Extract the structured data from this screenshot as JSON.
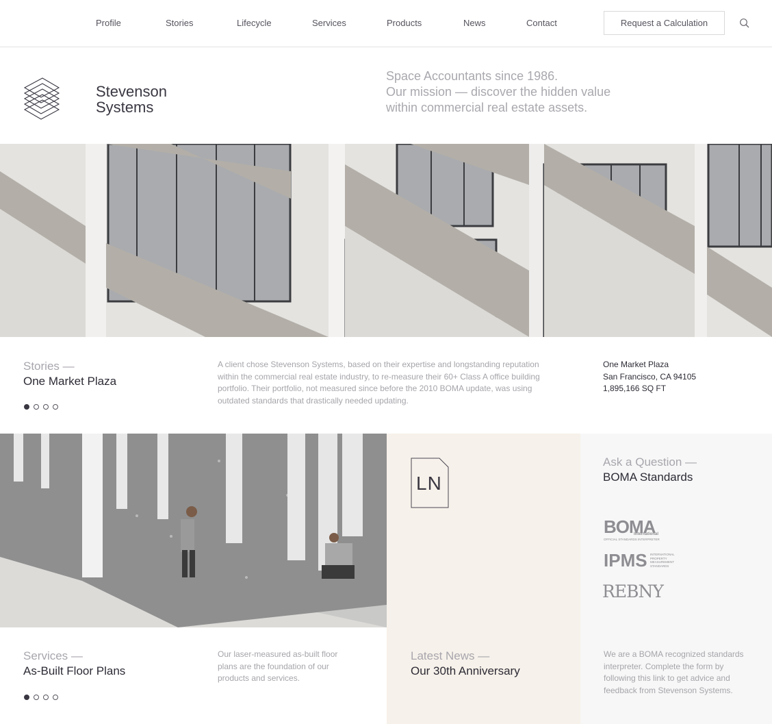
{
  "nav": {
    "items": [
      "Profile",
      "Stories",
      "Lifecycle",
      "Services",
      "Products",
      "News",
      "Contact"
    ],
    "cta": "Request a Calculation",
    "search_icon": "search-icon"
  },
  "brand": {
    "name_line1": "Stevenson",
    "name_line2": "Systems",
    "logo_icon": "stacked-lines-logo-icon"
  },
  "tagline": {
    "line1": "Space Accountants since 1986.",
    "line2": "Our mission — discover the hidden value",
    "line3": "within commercial real estate assets."
  },
  "stories": {
    "label": "Stories —",
    "title": "One Market Plaza",
    "body": "A client chose Stevenson Systems, based on their expertise and longstanding reputation within the commercial real estate industry, to re-measure their 60+ Class A office building portfolio. Their portfolio, not measured since before the 2010 BOMA update, was using outdated standards that drastically needed updating.",
    "address_line1": "One Market Plaza",
    "address_line2": "San Francisco, CA 94105",
    "address_line3": "1,895,166 SQ FT",
    "slides": 4,
    "active_slide": 1
  },
  "services": {
    "label": "Services —",
    "title": "As-Built Floor Plans",
    "body": "Our laser-measured as-built floor plans are the foundation of our products and services.",
    "slides": 4,
    "active_slide": 1
  },
  "news": {
    "icon_text": "LN",
    "label": "Latest News —",
    "title": "Our 30th Anniversary"
  },
  "ask": {
    "label": "Ask a Question —",
    "title": "BOMA Standards",
    "logo_boma": "BOMA",
    "logo_boma_sub": "International",
    "logo_boma_caption": "OFFICIAL STANDARDS INTERPRETER",
    "logo_ipms": "IPMS",
    "logo_ipms_caption": "INTERNATIONAL PROPERTY MEASUREMENT STANDARDS",
    "logo_rebny": "REBNY",
    "body": "We are a BOMA recognized  standards interpreter.  Complete the form by following this link to get advice and feedback from Stevenson Systems."
  },
  "colors": {
    "text_dark": "#2d2b35",
    "text_muted": "#a8a6ad",
    "news_bg": "#f6f1ea",
    "ask_bg": "#f7f7f7"
  }
}
